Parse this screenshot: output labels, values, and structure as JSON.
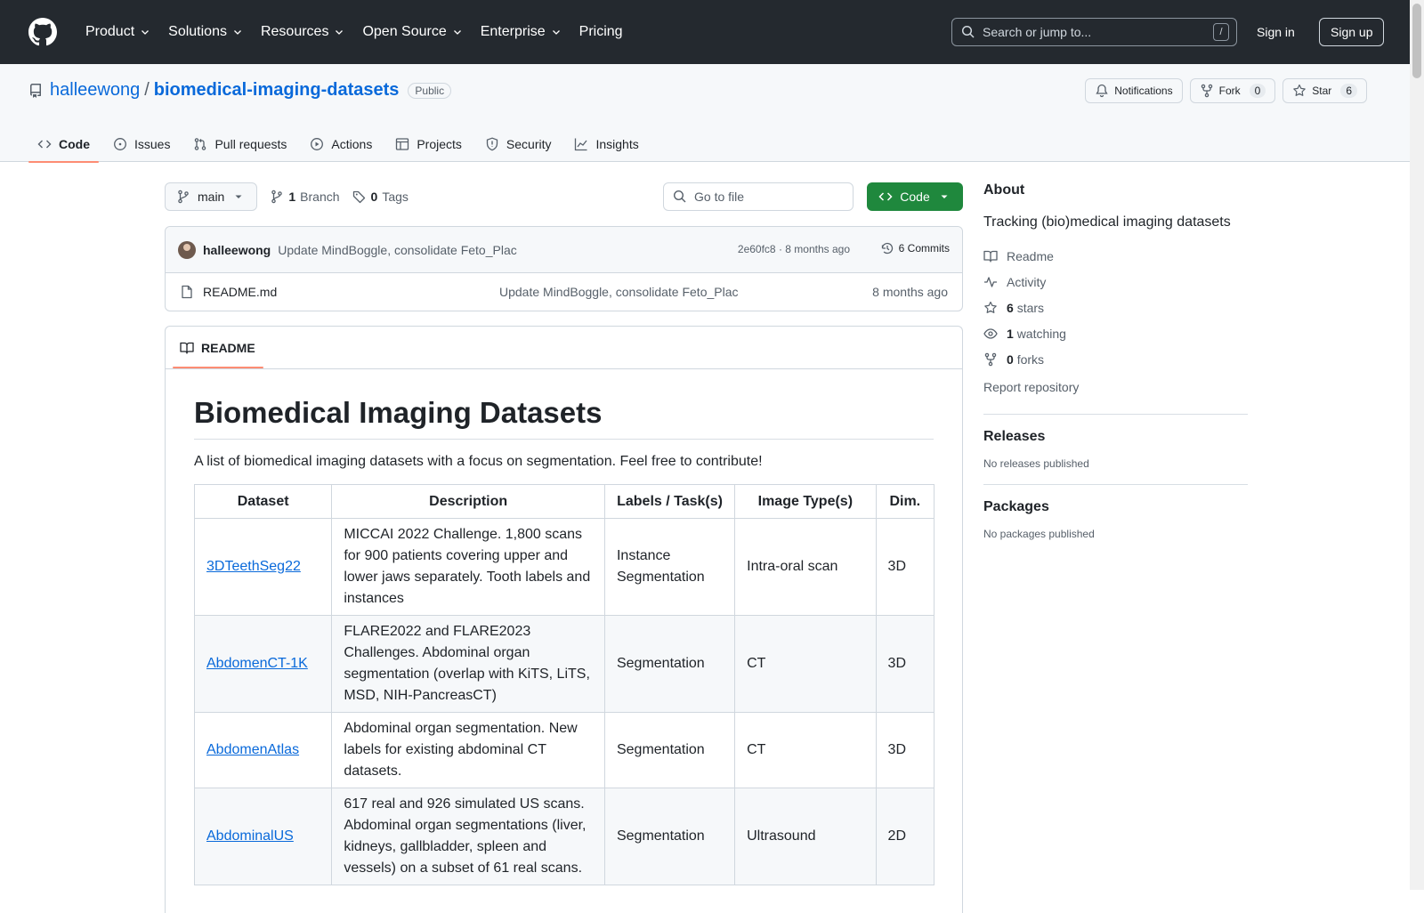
{
  "header": {
    "nav": [
      "Product",
      "Solutions",
      "Resources",
      "Open Source",
      "Enterprise",
      "Pricing"
    ],
    "search_placeholder": "Search or jump to...",
    "search_shortcut": "/",
    "signin": "Sign in",
    "signup": "Sign up"
  },
  "repo": {
    "owner": "halleewong",
    "separator": "/",
    "name": "biomedical-imaging-datasets",
    "visibility": "Public",
    "actions": {
      "notifications": "Notifications",
      "fork": "Fork",
      "fork_count": "0",
      "star": "Star",
      "star_count": "6"
    },
    "tabs": [
      "Code",
      "Issues",
      "Pull requests",
      "Actions",
      "Projects",
      "Security",
      "Insights"
    ]
  },
  "toolbar": {
    "branch": "main",
    "branch_count": "1",
    "branch_label": "Branch",
    "tag_count": "0",
    "tag_label": "Tags",
    "goto_file": "Go to file",
    "code_button": "Code"
  },
  "commit": {
    "author": "halleewong",
    "message": "Update MindBoggle, consolidate Feto_Plac",
    "meta": "2e60fc8 · 8 months ago",
    "commits": "6 Commits"
  },
  "files": [
    {
      "name": "README.md",
      "message": "Update MindBoggle, consolidate Feto_Plac",
      "date": "8 months ago"
    }
  ],
  "readme": {
    "tab_label": "README",
    "title": "Biomedical Imaging Datasets",
    "intro": "A list of biomedical imaging datasets with a focus on segmentation. Feel free to contribute!",
    "columns": [
      "Dataset",
      "Description",
      "Labels / Task(s)",
      "Image Type(s)",
      "Dim."
    ],
    "rows": [
      {
        "dataset": "3DTeethSeg22",
        "description": "MICCAI 2022 Challenge. 1,800 scans for 900 patients covering upper and lower jaws separately. Tooth labels and instances",
        "labels": "Instance Segmentation",
        "image_type": "Intra-oral scan",
        "dim": "3D"
      },
      {
        "dataset": "AbdomenCT-1K",
        "description": "FLARE2022 and FLARE2023 Challenges. Abdominal organ segmentation (overlap with KiTS, LiTS, MSD, NIH-PancreasCT)",
        "labels": "Segmentation",
        "image_type": "CT",
        "dim": "3D"
      },
      {
        "dataset": "AbdomenAtlas",
        "description": "Abdominal organ segmentation. New labels for existing abdominal CT datasets.",
        "labels": "Segmentation",
        "image_type": "CT",
        "dim": "3D"
      },
      {
        "dataset": "AbdominalUS",
        "description": "617 real and 926 simulated US scans. Abdominal organ segmentations (liver, kidneys, gallbladder, spleen and vessels) on a subset of 61 real scans.",
        "labels": "Segmentation",
        "image_type": "Ultrasound",
        "dim": "2D"
      }
    ]
  },
  "sidebar": {
    "about_title": "About",
    "description": "Tracking (bio)medical imaging datasets",
    "readme": "Readme",
    "activity": "Activity",
    "stars_count": "6",
    "stars_label": "stars",
    "watching_count": "1",
    "watching_label": "watching",
    "forks_count": "0",
    "forks_label": "forks",
    "report": "Report repository",
    "releases_title": "Releases",
    "releases_empty": "No releases published",
    "packages_title": "Packages",
    "packages_empty": "No packages published"
  }
}
